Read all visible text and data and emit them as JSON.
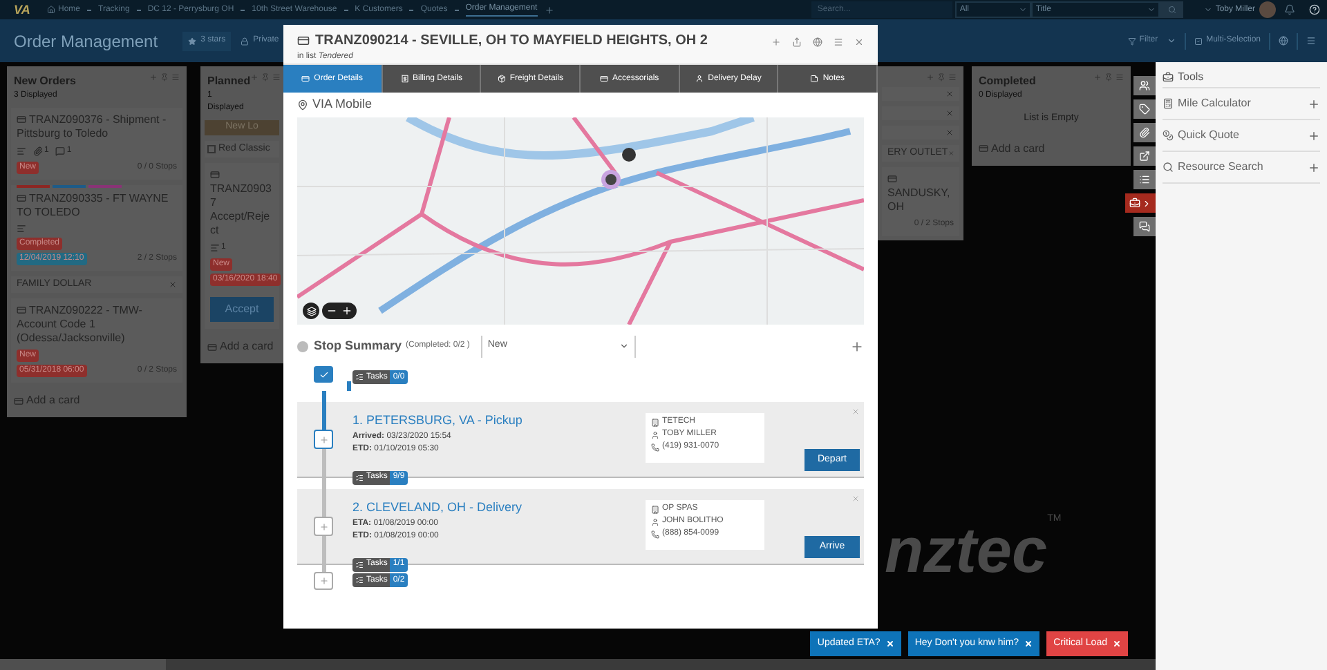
{
  "top_nav": {
    "logo": "VA",
    "breadcrumbs": [
      {
        "label": "Home",
        "selected": false
      },
      {
        "label": "Tracking",
        "selected": false
      },
      {
        "label": "DC 12 - Perrysburg OH",
        "selected": false
      },
      {
        "label": "10th Street Warehouse",
        "selected": false
      },
      {
        "label": "K Customers",
        "selected": false
      },
      {
        "label": "Quotes",
        "selected": false
      },
      {
        "label": "Order Management",
        "selected": true
      }
    ],
    "search": {
      "placeholder": "Search..."
    },
    "scope": "All",
    "field": "Title",
    "user": "Toby Miller"
  },
  "header": {
    "title": "Order Management",
    "stars_button": "3 stars",
    "privacy_button": "Private",
    "filter": "Filter",
    "multi_selection": "Multi-Selection"
  },
  "lists": [
    {
      "title": "New Orders",
      "subtitle": "3 Displayed",
      "items": [
        {
          "kind": "card",
          "title": "TRANZ090376 - Shipment - Pittsburg to Toledo",
          "meta": [
            {
              "kind": "checklist"
            },
            {
              "kind": "attachment",
              "count": "1"
            },
            {
              "kind": "comment",
              "count": "1"
            }
          ],
          "labels": [
            {
              "text": "New",
              "color": "#8e2f2c"
            }
          ],
          "stops": "0 / 0 Stops"
        },
        {
          "kind": "card",
          "colors": [
            {
              "color": "#8c2622"
            },
            {
              "color": "#1d5b88"
            },
            {
              "color": "#8a3376"
            }
          ],
          "title": "TRANZ090335 - FT WAYNE TO TOLEDO",
          "meta": [
            {
              "kind": "checklist"
            }
          ],
          "labels": [
            {
              "text": "Completed",
              "color": "#8e2f2c"
            },
            {
              "text": "12/04/2019 12:10",
              "color": "#226a83"
            }
          ],
          "stops": "2 / 2 Stops"
        },
        {
          "kind": "group",
          "title": "FAMILY DOLLAR"
        },
        {
          "kind": "card",
          "title": "TRANZ090222 - TMW- Account Code 1 (Odessa/Jacksonville)",
          "labels": [
            {
              "text": "New",
              "color": "#8e2f2c"
            },
            {
              "text": "05/31/2018 06:00",
              "color": "#8e2f2c"
            }
          ],
          "stops": "0 / 2 Stops"
        }
      ],
      "add_card": "Add a card"
    },
    {
      "title": "Planned",
      "subtitle": "1 Displayed",
      "items": [
        {
          "kind": "button",
          "text": "New Lo"
        },
        {
          "kind": "checkbox",
          "text": "Red Classic",
          "checked": false
        },
        {
          "kind": "card",
          "title": "TRANZ09037 Accept/Reject",
          "meta": [
            {
              "kind": "checklist",
              "count": "1"
            }
          ],
          "labels": [
            {
              "text": "New",
              "color": "#8e2f2c"
            },
            {
              "text": "03/16/2020 18:40",
              "color": "#8e2f2c"
            }
          ],
          "action": "Accept"
        }
      ],
      "add_card": "Add a card"
    },
    {
      "items": [
        {
          "kind": "row"
        },
        {
          "kind": "row"
        },
        {
          "kind": "row"
        },
        {
          "kind": "group",
          "title": "ERY OUTLET"
        },
        {
          "kind": "card",
          "title": "SANDUSKY, OH",
          "stops": "0 / 2 Stops"
        }
      ]
    },
    {
      "title": "Completed",
      "subtitle": "0 Displayed",
      "empty": "List is Empty",
      "add_card": "Add a card"
    }
  ],
  "background_logo": {
    "text": "nztec",
    "mark": "TM"
  },
  "modal": {
    "title": "TRANZ090214 - SEVILLE, OH TO MAYFIELD HEIGHTS, OH 2",
    "list_note": "in list *Tendered*",
    "tabs": [
      {
        "label": "Order Details",
        "kind": "details",
        "selected": true
      },
      {
        "label": "Billing Details",
        "kind": "billing",
        "selected": false
      },
      {
        "label": "Freight Details",
        "kind": "freight",
        "selected": false
      },
      {
        "label": "Accessorials",
        "kind": "accessorials",
        "selected": false
      },
      {
        "label": "Delivery Delay",
        "kind": "delay",
        "selected": false
      },
      {
        "label": "Notes",
        "kind": "notes",
        "selected": false
      }
    ],
    "source": "VIA Mobile",
    "stop_summary": {
      "title": "Stop Summary",
      "completed": "(Completed: 0/2 )",
      "status": "New",
      "all_done": true,
      "tasks_label": "Tasks",
      "tasks": "0/0",
      "stops": [
        {
          "title": "1. PETERSBURG, VA - Pickup",
          "reached": true,
          "times": [
            {
              "label": "Arrived:",
              "value": "03/23/2020 15:54"
            },
            {
              "label": "ETD:",
              "value": "01/10/2019 05:30"
            }
          ],
          "contact": {
            "company": "TETECH",
            "person": "TOBY MILLER",
            "phone": "(419) 931-0070"
          },
          "tasks_label": "Tasks",
          "tasks": "9/9",
          "action": "Depart"
        },
        {
          "title": "2. CLEVELAND, OH - Delivery",
          "reached": false,
          "times": [
            {
              "label": "ETA:",
              "value": "01/08/2019 00:00"
            },
            {
              "label": "ETD:",
              "value": "01/08/2019 00:00"
            }
          ],
          "contact": {
            "company": "OP SPAS",
            "person": "JOHN BOLITHO",
            "phone": "(888) 854-0099"
          },
          "tasks_label": "Tasks",
          "tasks": "1/1",
          "action": "Arrive"
        }
      ],
      "end_tasks_label": "Tasks",
      "end_tasks": "0/2"
    }
  },
  "side_icons": [
    {
      "kind": "users",
      "selected": false
    },
    {
      "kind": "tags",
      "selected": false
    },
    {
      "kind": "attachment",
      "selected": false
    },
    {
      "kind": "external",
      "selected": false
    },
    {
      "kind": "list",
      "selected": false
    },
    {
      "kind": "tools",
      "selected": true
    },
    {
      "kind": "chat",
      "selected": false
    }
  ],
  "tools": {
    "title": "Tools",
    "items": [
      {
        "kind": "calculator",
        "label": "Mile Calculator"
      },
      {
        "kind": "quote",
        "label": "Quick Quote"
      },
      {
        "kind": "search",
        "label": "Resource Search"
      }
    ]
  },
  "toasts": [
    {
      "text": "Updated ETA?",
      "color": "#0e73b8"
    },
    {
      "text": "Hey Don't you knw him?",
      "color": "#0e73b8"
    },
    {
      "text": "Critical Load",
      "color": "#e04444"
    }
  ]
}
